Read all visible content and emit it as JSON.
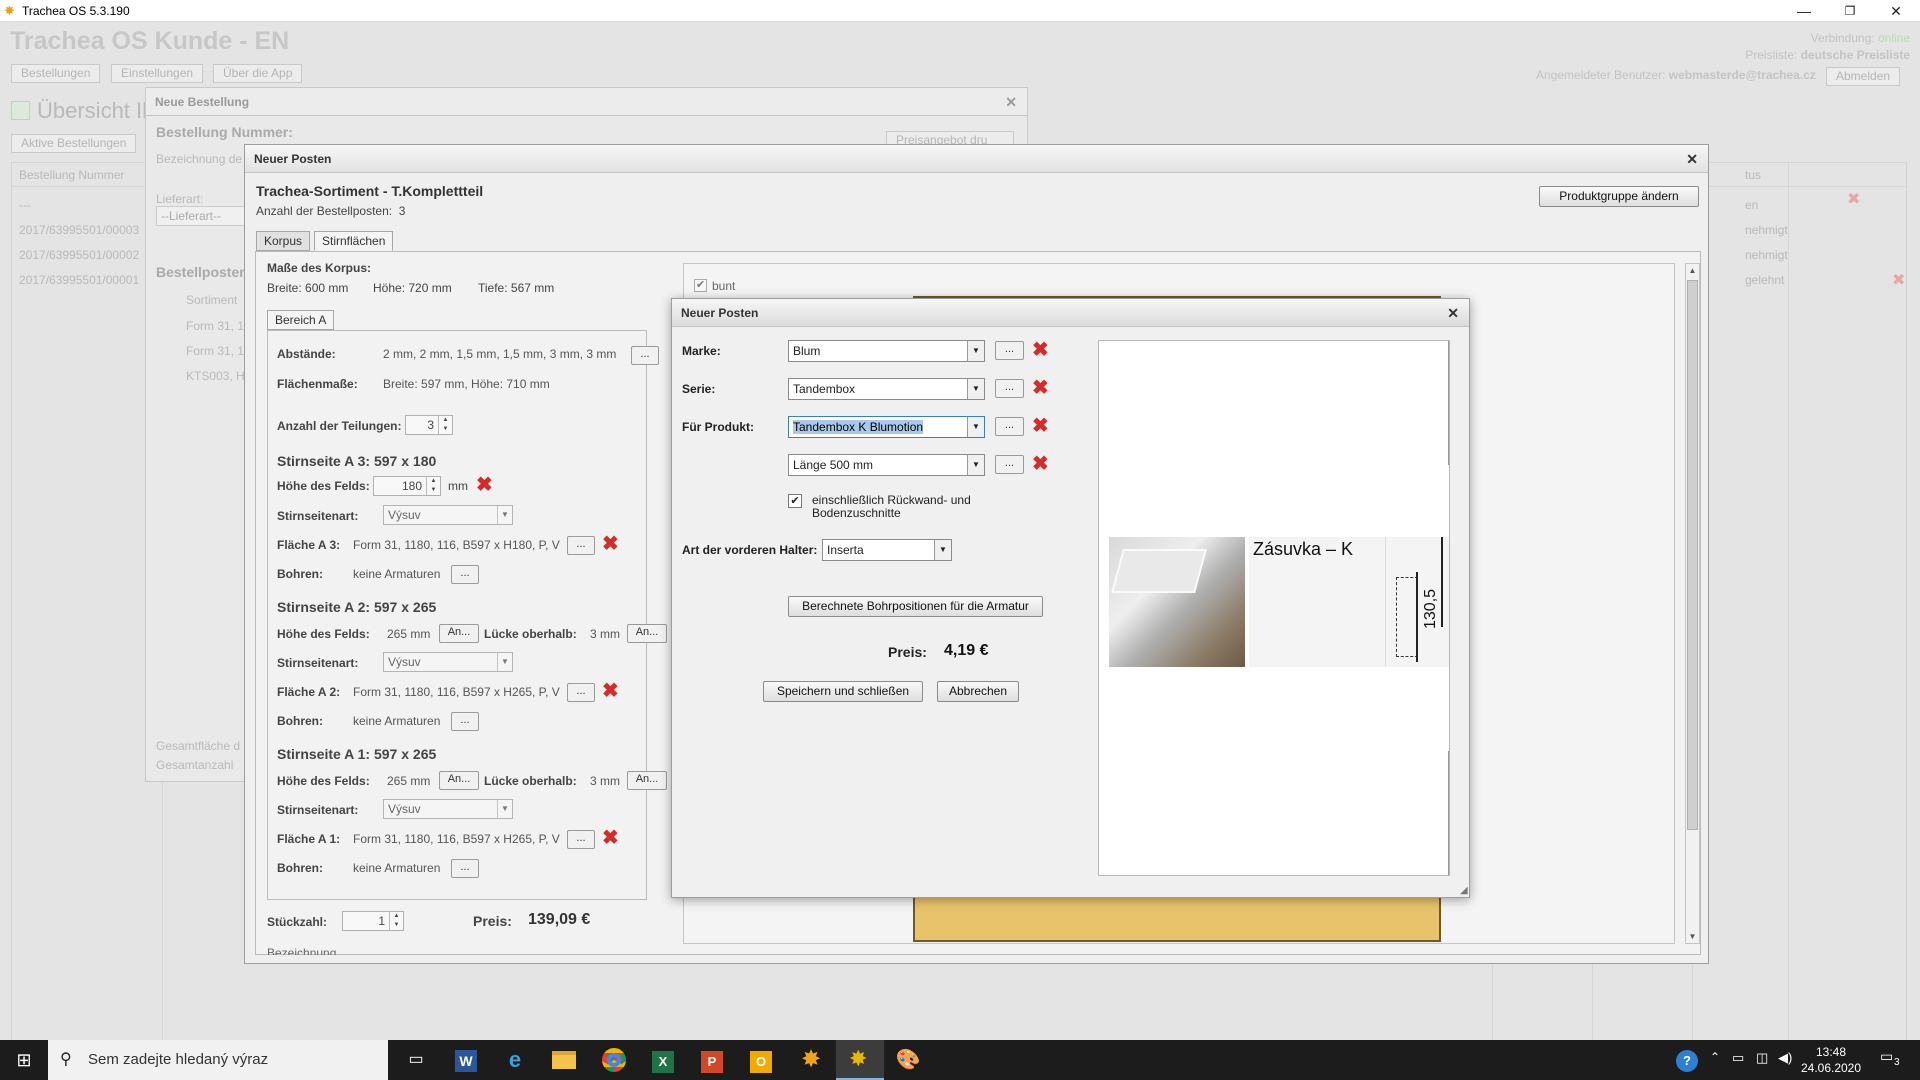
{
  "window": {
    "title": "Trachea OS 5.3.190",
    "minimize": "—",
    "maximize": "❐",
    "close": "✕"
  },
  "app": {
    "title": "Trachea OS Kunde - EN",
    "nav": [
      "Bestellungen",
      "Einstellungen",
      "Über die App"
    ],
    "status_conn_label": "Verbindung:",
    "status_conn_value": "online",
    "status_pl_label": "Preisliste:",
    "status_pl_value": "deutsche Preisliste",
    "user_label": "Angemeldeter Benutzer:",
    "user_value": "webmasterde@trachea.cz",
    "logout": "Abmelden",
    "overview": "Übersicht Ih",
    "active_orders": "Aktive Bestellungen",
    "col_order": "Bestellung Nummer",
    "col_status": "tus",
    "rows": [
      "---",
      "2017/63995501/00003",
      "2017/63995501/00002",
      "2017/63995501/00001"
    ],
    "status_rows": [
      "en",
      "nehmigt",
      "nehmigt",
      "gelehnt"
    ]
  },
  "order": {
    "title": "Neue Bestellung",
    "number_label": "Bestellung Nummer:",
    "bez_label": "Bezeichnung de",
    "liefer_label": "Lieferart:",
    "liefer_value": "--Lieferart--",
    "print_btn": "Preisangebot dru",
    "positions": "Bestellposten",
    "col_sort": "Sortiment",
    "rows": [
      "Form 31, 1",
      "Form 31, 1",
      "KTS003, H"
    ],
    "sum1": "Gesamtfläche d",
    "sum2": "Gesamtanzahl"
  },
  "posten": {
    "title": "Neuer Posten",
    "heading": "Trachea-Sortiment - T.Komplettteil",
    "count_label": "Anzahl der Bestellposten:",
    "count": "3",
    "change_btn": "Produktgruppe ändern",
    "tabs": [
      "Korpus",
      "Stirnflächen"
    ],
    "korpus_label": "Maße des Korpus:",
    "breite": "Breite:  600  mm",
    "hoehe": "Höhe:  720  mm",
    "tiefe": "Tiefe:  567  mm",
    "bereich_tab": "Bereich A",
    "abstaende_label": "Abstände:",
    "abstaende_value": "2 mm, 2 mm, 1,5 mm, 1,5 mm, 3 mm, 3 mm",
    "flaechen_label": "Flächenmaße:",
    "flaechen_value": "Breite: 597 mm, Höhe: 710 mm",
    "teilungen_label": "Anzahl der Teilungen:",
    "teilungen": "3",
    "feld_label": "Höhe des Felds:",
    "art_label": "Stirnseitenart:",
    "art_value": "Výsuv",
    "bohren_label": "Bohren:",
    "bohren_value": "keine Armaturen",
    "luecke_label": "Lücke oberhalb:",
    "an": "An...",
    "dots": "...",
    "mm": "mm",
    "sections": [
      {
        "title": "Stirnseite A 3: 597 x 180",
        "feld": "180",
        "flaeche_label": "Fläche A 3:",
        "flaeche": "Form 31, 1180, 116, B597 x H180, P, V"
      },
      {
        "title": "Stirnseite A 2: 597 x 265",
        "feld": "265 mm",
        "luecke": "3 mm",
        "flaeche_label": "Fläche A 2:",
        "flaeche": "Form 31, 1180, 116, B597 x H265, P, V"
      },
      {
        "title": "Stirnseite A 1: 597 x 265",
        "feld": "265 mm",
        "luecke": "3 mm",
        "flaeche_label": "Fläche A 1:",
        "flaeche": "Form 31, 1180, 116, B597 x H265, P, V"
      }
    ],
    "stueck_label": "Stückzahl:",
    "stueck": "1",
    "preis_label": "Preis:",
    "preis": "139,09 €",
    "bez_cut": "Bezeichnung",
    "bunt": "bunt"
  },
  "dialog": {
    "title": "Neuer Posten",
    "marke_label": "Marke:",
    "marke": "Blum",
    "serie_label": "Serie:",
    "serie": "Tandembox",
    "produkt_label": "Für Produkt:",
    "produkt": "Tandembox K Blumotion",
    "laenge": "Länge 500 mm",
    "checkbox_label": "einschließlich Rückwand- und Bodenzuschnitte",
    "halter_label": "Art der vorderen Halter:",
    "halter": "Inserta",
    "calc_btn": "Berechnete Bohrpositionen für die Armatur",
    "preis_label": "Preis:",
    "preis": "4,19 €",
    "save_btn": "Speichern und schließen",
    "cancel_btn": "Abbrechen",
    "preview_title": "Zásuvka – K",
    "preview_dim": "130,5"
  },
  "taskbar": {
    "search": "Sem zadejte hledaný výraz",
    "time": "13:48",
    "date": "24.06.2020",
    "notif": "3"
  }
}
